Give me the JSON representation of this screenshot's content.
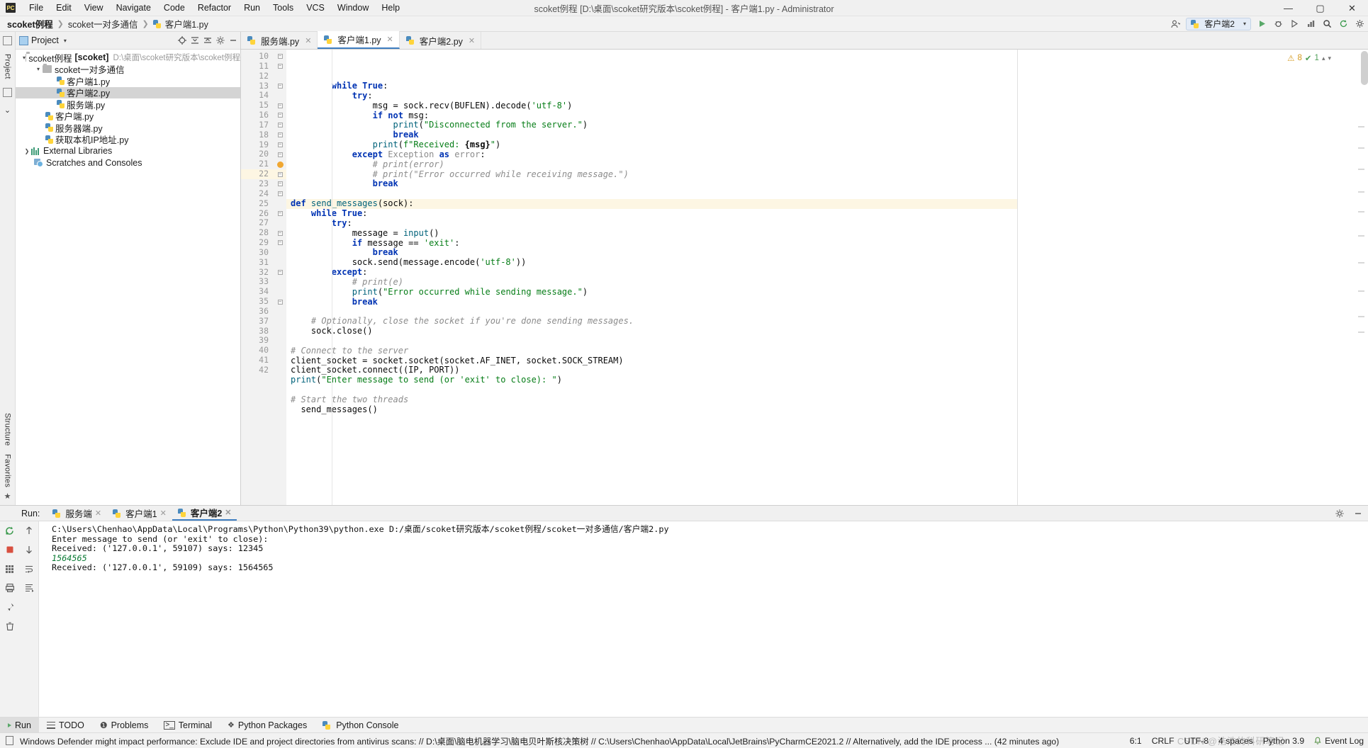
{
  "window": {
    "title": "scoket例程 [D:\\桌面\\scoket研究版本\\scoket例程] - 客户端1.py - Administrator",
    "logo": "PC",
    "minimize": "—",
    "maximize": "▢",
    "close": "✕"
  },
  "menubar": [
    "File",
    "Edit",
    "View",
    "Navigate",
    "Code",
    "Refactor",
    "Run",
    "Tools",
    "VCS",
    "Window",
    "Help"
  ],
  "breadcrumb": {
    "project": "scoket例程",
    "folder": "scoket一对多通信",
    "file": "客户端1.py"
  },
  "toolbar_right": {
    "run_config": "客户端2",
    "icons": [
      "user-icon",
      "run-icon",
      "debug-icon",
      "coverage-icon",
      "profile-icon",
      "search-icon",
      "update-icon",
      "settings-icon"
    ]
  },
  "project_panel": {
    "title": "Project",
    "tree": [
      {
        "label": "scoket例程",
        "bold_suffix": "[scoket]",
        "path": "D:\\桌面\\scoket研究版本\\scoket例程",
        "icon": "folder-icon",
        "indent": 0,
        "arrow": "v",
        "selected": false
      },
      {
        "label": "scoket一对多通信",
        "icon": "folder-icon",
        "indent": 1,
        "arrow": "v",
        "selected": false
      },
      {
        "label": "客户端1.py",
        "icon": "python-file-icon",
        "indent": 2,
        "arrow": "",
        "selected": false
      },
      {
        "label": "客户端2.py",
        "icon": "python-file-icon",
        "indent": 2,
        "arrow": "",
        "selected": true
      },
      {
        "label": "服务端.py",
        "icon": "python-file-icon",
        "indent": 2,
        "arrow": "",
        "selected": false
      },
      {
        "label": "客户端.py",
        "icon": "python-file-icon",
        "indent": 1,
        "arrow": "",
        "selected": false
      },
      {
        "label": "服务器端.py",
        "icon": "python-file-icon",
        "indent": 1,
        "arrow": "",
        "selected": false
      },
      {
        "label": "获取本机IP地址.py",
        "icon": "python-file-icon",
        "indent": 1,
        "arrow": "",
        "selected": false
      },
      {
        "label": "External Libraries",
        "icon": "library-icon",
        "indent": 0,
        "arrow": ">",
        "selected": false
      },
      {
        "label": "Scratches and Consoles",
        "icon": "scratches-icon",
        "indent": 0,
        "arrow": "",
        "selected": false
      }
    ]
  },
  "left_stripe": {
    "top": "Project",
    "bottom": [
      "Structure",
      "Favorites"
    ]
  },
  "editor": {
    "tabs": [
      {
        "label": "服务端.py",
        "active": false
      },
      {
        "label": "客户端1.py",
        "active": true
      },
      {
        "label": "客户端2.py",
        "active": false
      }
    ],
    "inspection": {
      "warnings": "8",
      "oks": "1"
    },
    "first_line": 10,
    "highlight_line": 22,
    "bulb_line": 21,
    "lines": [
      {
        "n": 10,
        "fold": "-",
        "html": "        <span class='kw'>while</span> <span class='kw'>True</span>:"
      },
      {
        "n": 11,
        "fold": "-",
        "html": "            <span class='kw'>try</span>:"
      },
      {
        "n": 12,
        "fold": "",
        "html": "                msg = sock.recv(BUFLEN).decode(<span class='str'>'utf-8'</span>)"
      },
      {
        "n": 13,
        "fold": "-",
        "html": "                <span class='kw'>if</span> <span class='kw'>not</span> msg:"
      },
      {
        "n": 14,
        "fold": "",
        "html": "                    <span class='fn'>print</span>(<span class='str'>\"Disconnected from the server.\"</span>)"
      },
      {
        "n": 15,
        "fold": "-",
        "html": "                    <span class='kw'>break</span>"
      },
      {
        "n": 16,
        "fold": "-",
        "html": "                <span class='fn'>print</span>(<span class='str'>f\"Received: </span><span class='fbrace'>{msg}</span><span class='str'>\"</span>)"
      },
      {
        "n": 17,
        "fold": "-",
        "html": "            <span class='kw'>except</span> <span class='err'>Exception</span> <span class='kw'>as</span> <span class='err'>error</span>:"
      },
      {
        "n": 18,
        "fold": "-",
        "html": "                <span class='cm'># print(error)</span>"
      },
      {
        "n": 19,
        "fold": "-",
        "html": "                <span class='cm'># print(\"Error occurred while receiving message.\")</span>"
      },
      {
        "n": 20,
        "fold": "-",
        "html": "                <span class='kw'>break</span>"
      },
      {
        "n": 21,
        "fold": "bulb",
        "html": ""
      },
      {
        "n": 22,
        "fold": "-",
        "html": "<span class='kw'>def</span> <span class='fn'>send_messages</span>(sock):"
      },
      {
        "n": 23,
        "fold": "-",
        "html": "    <span class='kw'>while</span> <span class='kw'>True</span>:"
      },
      {
        "n": 24,
        "fold": "-",
        "html": "        <span class='kw'>try</span>:"
      },
      {
        "n": 25,
        "fold": "",
        "html": "            message = <span class='fn'>input</span>()"
      },
      {
        "n": 26,
        "fold": "-",
        "html": "            <span class='kw'>if</span> message == <span class='str'>'exit'</span>:"
      },
      {
        "n": 27,
        "fold": "",
        "html": "                <span class='kw'>break</span>"
      },
      {
        "n": 28,
        "fold": "-",
        "html": "            sock.send(message.encode(<span class='str'>'utf-8'</span>))"
      },
      {
        "n": 29,
        "fold": "-",
        "html": "        <span class='kw'>except</span>:"
      },
      {
        "n": 30,
        "fold": "",
        "html": "            <span class='cm'># print(e)</span>"
      },
      {
        "n": 31,
        "fold": "",
        "html": "            <span class='fn'>print</span>(<span class='str'>\"Error occurred while sending message.\"</span>)"
      },
      {
        "n": 32,
        "fold": "-",
        "html": "            <span class='kw'>break</span>"
      },
      {
        "n": 33,
        "fold": "",
        "html": ""
      },
      {
        "n": 34,
        "fold": "",
        "html": "    <span class='cm'># Optionally, close the socket if you're done sending messages.</span>"
      },
      {
        "n": 35,
        "fold": "-",
        "html": "    sock.close()"
      },
      {
        "n": 36,
        "fold": "",
        "html": ""
      },
      {
        "n": 37,
        "fold": "",
        "html": "<span class='cm'># Connect to the server</span>"
      },
      {
        "n": 38,
        "fold": "",
        "html": "client_socket = socket.socket(socket.AF_INET, socket.SOCK_STREAM)"
      },
      {
        "n": 39,
        "fold": "",
        "html": "client_socket.connect((IP, PORT))"
      },
      {
        "n": 40,
        "fold": "",
        "html": "<span class='fn'>print</span>(<span class='str'>\"Enter message to send (or 'exit' to close): \"</span>)"
      },
      {
        "n": 41,
        "fold": "",
        "html": ""
      },
      {
        "n": 42,
        "fold": "",
        "html": "<span class='cm'># Start the two threads</span>"
      },
      {
        "n": "",
        "fold": "",
        "html": "  send_messages()"
      }
    ]
  },
  "run_panel": {
    "label": "Run:",
    "tabs": [
      {
        "label": "服务端",
        "active": false
      },
      {
        "label": "客户端1",
        "active": false
      },
      {
        "label": "客户端2",
        "active": true
      }
    ],
    "console_lines": [
      {
        "text": "C:\\Users\\Chenhao\\AppData\\Local\\Programs\\Python\\Python39\\python.exe D:/桌面/scoket研究版本/scoket例程/scoket一对多通信/客户端2.py",
        "style": "normal"
      },
      {
        "text": "Enter message to send (or 'exit' to close):",
        "style": "normal"
      },
      {
        "text": "Received: ('127.0.0.1', 59107) says: 12345",
        "style": "normal"
      },
      {
        "text": "1564565",
        "style": "green"
      },
      {
        "text": "Received: ('127.0.0.1', 59109) says: 1564565",
        "style": "normal"
      }
    ],
    "side_icons": [
      "rerun-icon",
      "up-arrow-icon",
      "down-arrow-icon",
      "stop-icon",
      "soft-wrap-icon",
      "scroll-end-icon",
      "print-icon",
      "pin-icon",
      "trash-icon"
    ],
    "right_icons": [
      "settings-icon",
      "hide-icon"
    ]
  },
  "toolwindow_bar": [
    {
      "label": "Run",
      "icon": "run-icon",
      "active": true
    },
    {
      "label": "TODO",
      "icon": "todo-icon",
      "active": false
    },
    {
      "label": "Problems",
      "icon": "problems-icon",
      "active": false
    },
    {
      "label": "Terminal",
      "icon": "terminal-icon",
      "active": false
    },
    {
      "label": "Python Packages",
      "icon": "packages-icon",
      "active": false
    },
    {
      "label": "Python Console",
      "icon": "python-console-icon",
      "active": false
    }
  ],
  "statusbar": {
    "message": "Windows Defender might impact performance: Exclude IDE and project directories from antivirus scans: // D:\\桌面\\脑电机器学习\\脑电贝叶斯核决策树 // C:\\Users\\Chenhao\\AppData\\Local\\JetBrains\\PyCharmCE2021.2 // Alternatively, add the IDE process ... (42 minutes ago)",
    "caret": "6:1",
    "line_sep": "CRLF",
    "encoding": "UTF-8",
    "indent": "4 spaces",
    "interpreter": "Python 3.9",
    "event_log": "Event Log",
    "watermark": "CSDN @浩浩的科研笔记"
  },
  "colors": {
    "accent": "#3e7ec1",
    "keyword": "#0033b3",
    "string": "#067d17",
    "comment": "#8c8c8c",
    "highlight": "#fdf6e3",
    "green_run": "#59a869"
  }
}
